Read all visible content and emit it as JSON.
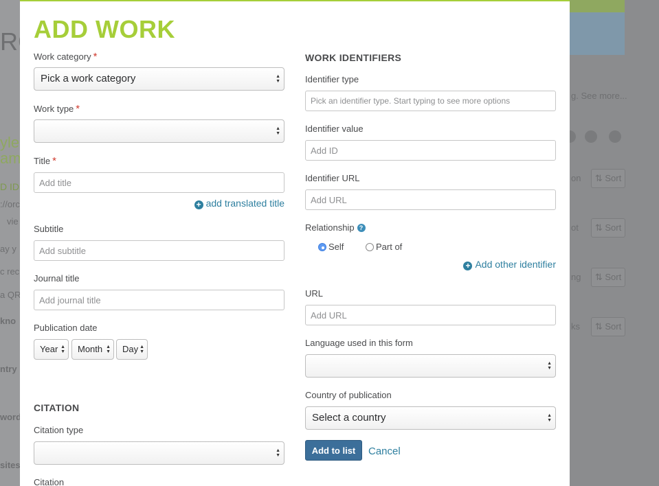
{
  "background": {
    "fragments": [
      "RC",
      "yle",
      "am",
      "D ID",
      "://orc",
      "vie",
      "ay y",
      "c rec",
      "a QR",
      "kno",
      "ntry",
      "word",
      "sites"
    ],
    "see_more": "g. See more...",
    "sort_label": "Sort",
    "row_labels": [
      "on",
      "ot",
      "ng",
      "ks"
    ]
  },
  "modal": {
    "title": "ADD WORK",
    "left": {
      "work_category": {
        "label": "Work category",
        "required": "*",
        "value": "Pick a work category"
      },
      "work_type": {
        "label": "Work type",
        "required": "*",
        "value": ""
      },
      "title": {
        "label": "Title",
        "required": "*",
        "placeholder": "Add title"
      },
      "add_translated_title": "add translated title",
      "subtitle": {
        "label": "Subtitle",
        "placeholder": "Add subtitle"
      },
      "journal_title": {
        "label": "Journal title",
        "placeholder": "Add journal title"
      },
      "publication_date": {
        "label": "Publication date",
        "year": "Year",
        "month": "Month",
        "day": "Day"
      },
      "citation_section": "CITATION",
      "citation_type": {
        "label": "Citation type",
        "value": ""
      },
      "citation": {
        "label": "Citation"
      }
    },
    "right": {
      "section": "WORK IDENTIFIERS",
      "identifier_type": {
        "label": "Identifier type",
        "placeholder": "Pick an identifier type. Start typing to see more options"
      },
      "identifier_value": {
        "label": "Identifier value",
        "placeholder": "Add ID"
      },
      "identifier_url": {
        "label": "Identifier URL",
        "placeholder": "Add URL"
      },
      "relationship": {
        "label": "Relationship",
        "help": "?",
        "options": [
          "Self",
          "Part of"
        ],
        "selected": "Self"
      },
      "add_other_identifier": "Add other identifier",
      "url": {
        "label": "URL",
        "placeholder": "Add URL"
      },
      "language": {
        "label": "Language used in this form",
        "value": ""
      },
      "country": {
        "label": "Country of publication",
        "value": "Select a country"
      },
      "add_to_list": "Add to list",
      "cancel": "Cancel"
    }
  },
  "colors": {
    "accent_green": "#a6ce39",
    "link_blue": "#2e7f9f",
    "primary_button": "#3c6f9a",
    "required_red": "#d03b2f"
  }
}
